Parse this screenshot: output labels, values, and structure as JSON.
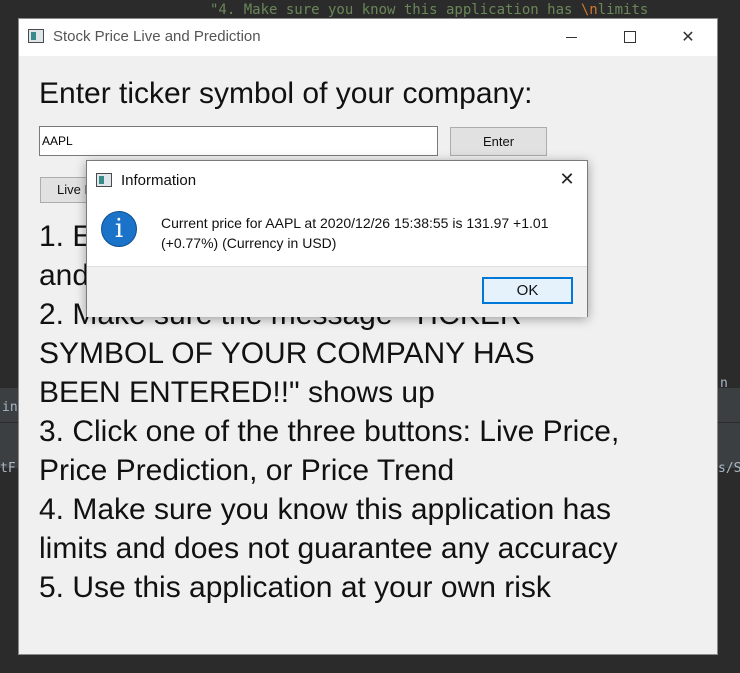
{
  "background": {
    "top_code_line_pre": "\"4. Make sure you know this application has ",
    "top_code_line_esc": "\\n",
    "top_code_line_post": "limits",
    "left_fragment_1": "ini",
    "left_fragment_2": "tF",
    "right_fragment_1": "n",
    "right_fragment_2": "s/S"
  },
  "window": {
    "title": "Stock Price Live and Prediction",
    "controls": {
      "close": "✕"
    }
  },
  "form": {
    "prompt": "Enter ticker symbol of your company:",
    "ticker_value": "AAPL",
    "enter_label": "Enter",
    "live_label": "Live P"
  },
  "instructions": [
    "1. Enter ticker symbol of your company",
    "and then click Enter",
    "2. Make sure the message \"TICKER",
    "SYMBOL OF YOUR COMPANY HAS",
    "BEEN ENTERED!!\" shows up",
    "3. Click one of the three buttons: Live Price,",
    "Price Prediction, or Price Trend",
    "4. Make sure you know this application has",
    "limits and does not guarantee any accuracy",
    "5. Use this application at your own risk"
  ],
  "dialog": {
    "title": "Information",
    "close": "✕",
    "icon": "i",
    "message_line1": "Current price for AAPL at 2020/12/26 15:38:55 is 131.97 +1.01",
    "message_line2": "(+0.77%) (Currency in USD)",
    "ok_label": "OK"
  }
}
